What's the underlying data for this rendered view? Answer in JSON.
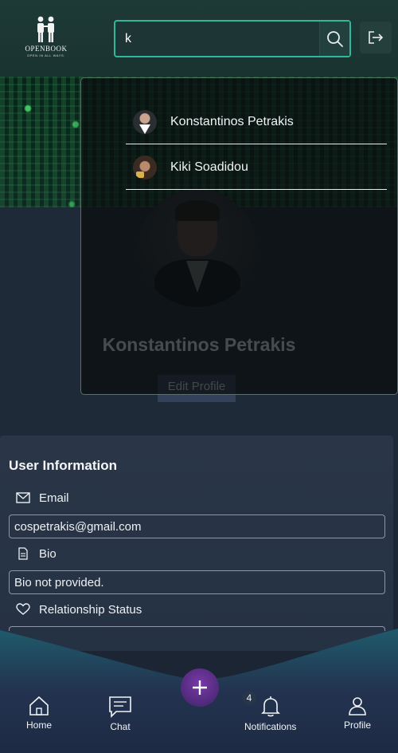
{
  "app": {
    "logo_name": "OPENBOOK",
    "logo_tagline": "OPEN IN ALL WAYS."
  },
  "search": {
    "value": "k"
  },
  "search_results": [
    {
      "name": "Konstantinos Petrakis"
    },
    {
      "name": "Kiki Soadidou"
    }
  ],
  "profile": {
    "name": "Konstantinos Petrakis",
    "edit_label": "Edit Profile"
  },
  "user_info": {
    "title": "User Information",
    "email_label": "Email",
    "email_value": "cospetrakis@gmail.com",
    "bio_label": "Bio",
    "bio_value": "Bio not provided.",
    "relationship_label": "Relationship Status"
  },
  "bottom_nav": {
    "home": "Home",
    "chat": "Chat",
    "notifications": "Notifications",
    "notifications_count": "4",
    "profile": "Profile"
  },
  "colors": {
    "accent": "#2fb89a",
    "fab": "#6a35a0",
    "card": "#2a3647"
  }
}
